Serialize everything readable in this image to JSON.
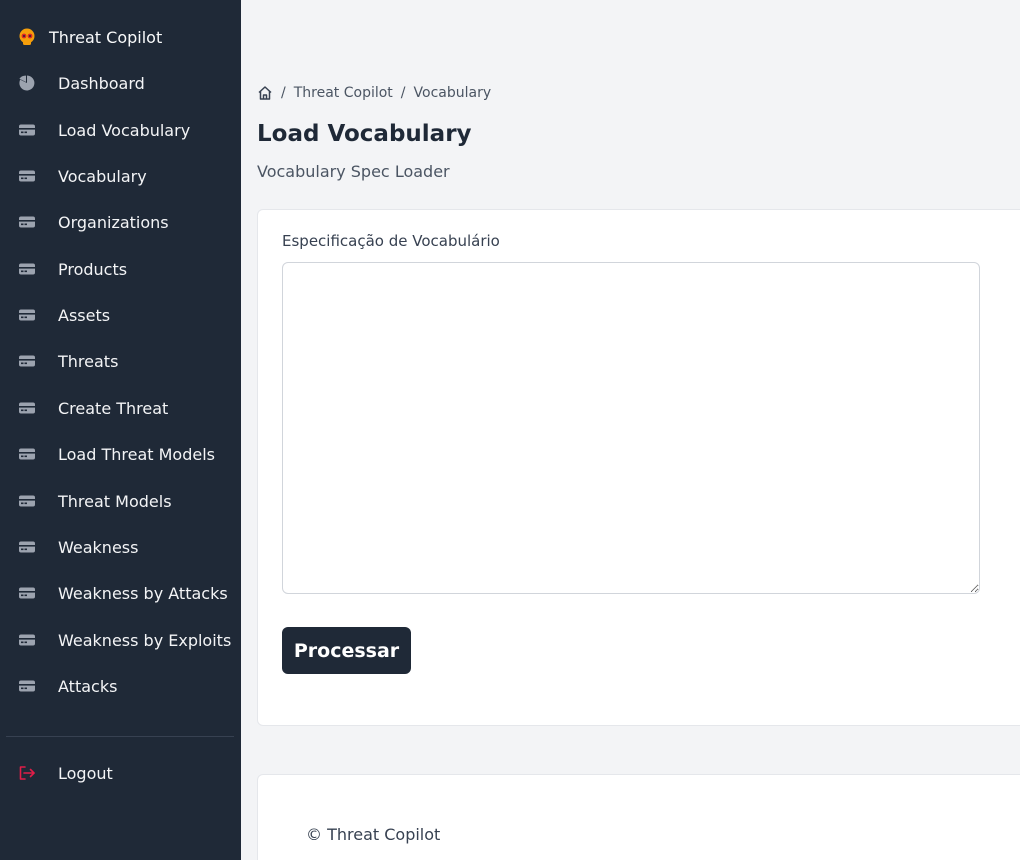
{
  "app": {
    "name": "Threat Copilot"
  },
  "sidebar": {
    "items": [
      {
        "label": "Dashboard",
        "icon": "pie-chart-icon"
      },
      {
        "label": "Load Vocabulary",
        "icon": "card-icon"
      },
      {
        "label": "Vocabulary",
        "icon": "card-icon"
      },
      {
        "label": "Organizations",
        "icon": "card-icon"
      },
      {
        "label": "Products",
        "icon": "card-icon"
      },
      {
        "label": "Assets",
        "icon": "card-icon"
      },
      {
        "label": "Threats",
        "icon": "card-icon"
      },
      {
        "label": "Create Threat",
        "icon": "card-icon"
      },
      {
        "label": "Load Threat Models",
        "icon": "card-icon"
      },
      {
        "label": "Threat Models",
        "icon": "card-icon"
      },
      {
        "label": "Weakness",
        "icon": "card-icon"
      },
      {
        "label": "Weakness by Attacks",
        "icon": "card-icon"
      },
      {
        "label": "Weakness by Exploits",
        "icon": "card-icon"
      },
      {
        "label": "Attacks",
        "icon": "card-icon"
      }
    ],
    "logout": {
      "label": "Logout",
      "icon": "logout-icon"
    }
  },
  "breadcrumb": {
    "items": [
      "Threat Copilot",
      "Vocabulary"
    ]
  },
  "page": {
    "title": "Load Vocabulary",
    "subtitle": "Vocabulary Spec Loader"
  },
  "form": {
    "field_label": "Especificação de Vocabulário",
    "value": "",
    "submit_label": "Processar"
  },
  "footer": {
    "text": "© Threat Copilot"
  },
  "colors": {
    "sidebar_bg": "#1f2937",
    "page_bg": "#f3f4f6",
    "logout_icon": "#e11d48"
  }
}
